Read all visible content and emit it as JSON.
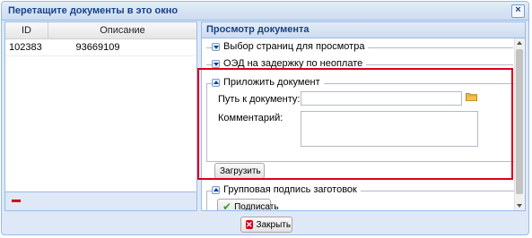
{
  "window": {
    "title": "Перетащите документы в это окно",
    "close_symbol": "×"
  },
  "grid": {
    "columns": [
      "ID",
      "Описание"
    ],
    "rows": [
      {
        "id": "102383",
        "desc": "93669109"
      }
    ]
  },
  "left_footer": {
    "remove_icon": "minus-icon",
    "remove_color": "#d0021b"
  },
  "preview": {
    "title": "Просмотр документа",
    "fieldsets": [
      {
        "label": "Выбор страниц для просмотра",
        "collapsed": true
      },
      {
        "label": "ОЭД на задержку по неоплате",
        "collapsed": true
      },
      {
        "label": "Приложить документ",
        "collapsed": false
      },
      {
        "label": "Групповая подпись заготовок",
        "collapsed": false
      }
    ],
    "attach": {
      "path_label": "Путь к документу:",
      "path_value": "",
      "comment_label": "Комментарий:",
      "comment_value": "",
      "upload_label": "Загрузить"
    },
    "sign_label": "Подписать"
  },
  "footer": {
    "close_label": "Закрыть"
  },
  "colors": {
    "highlight_frame": "#d9001b",
    "header_text": "#15428b",
    "window_bg": "#dfe8f6"
  }
}
